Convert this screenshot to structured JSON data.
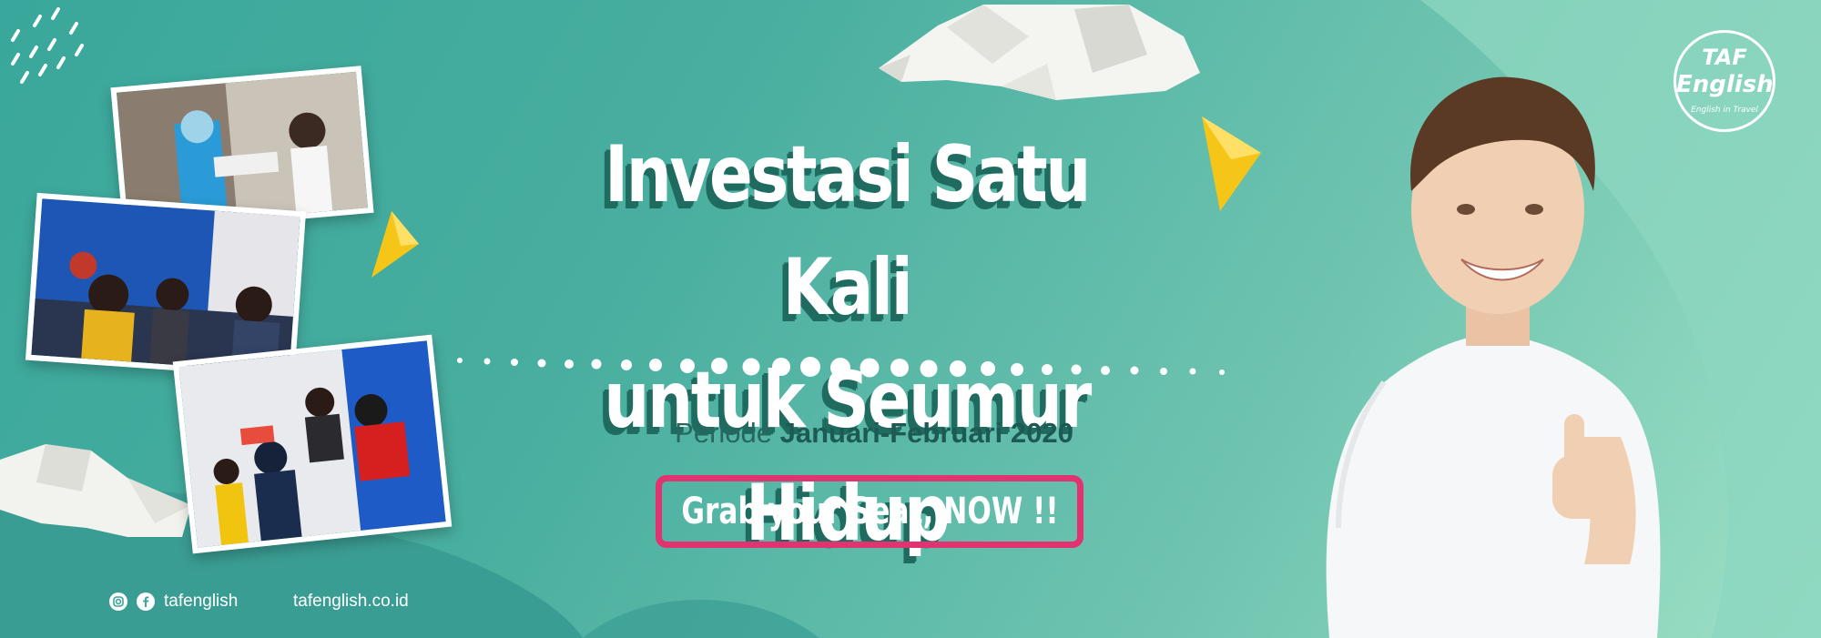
{
  "headline": {
    "line1": "Investasi Satu Kali",
    "line2": "untuk Seumur Hidup"
  },
  "periode": {
    "prefix": "Periode",
    "dates": "Januari-Februari 2020"
  },
  "cta": {
    "label": "Grab your Seat, NOW !!"
  },
  "footer": {
    "social_handle": "tafenglish",
    "website": "tafenglish.co.id"
  },
  "logo": {
    "line1": "TAF",
    "line2": "English",
    "tagline": "English in Travel"
  },
  "colors": {
    "accent": "#e0336f",
    "teal": "#3aa79c",
    "dark_teal": "#1f6b60",
    "triangle": "#f5c518"
  }
}
